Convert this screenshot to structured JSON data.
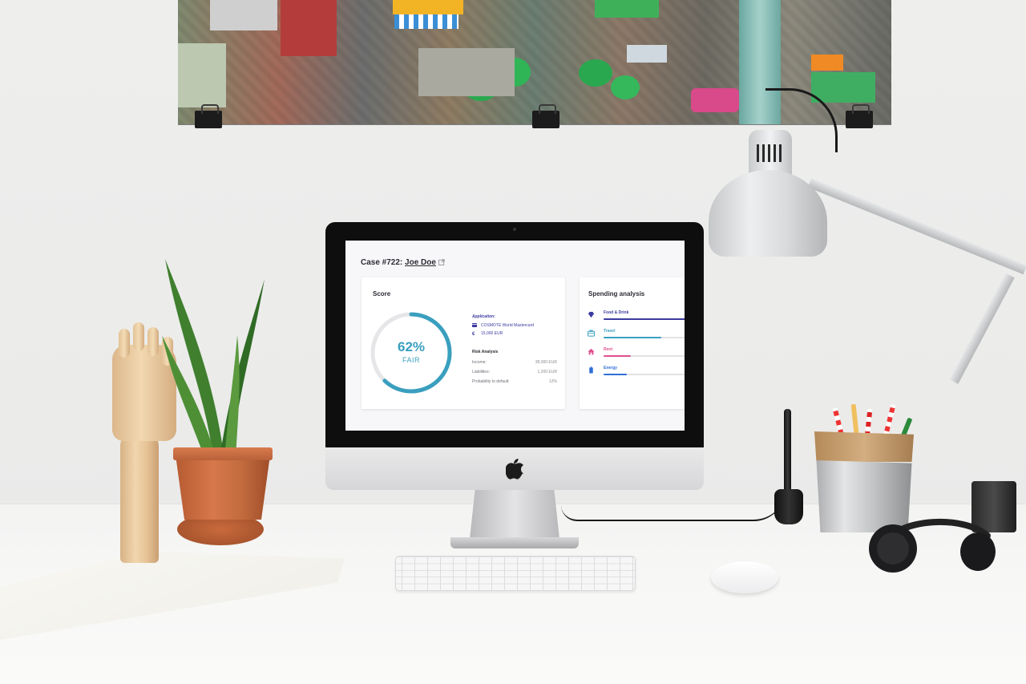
{
  "scene": {
    "description_objects": [
      "poster",
      "imac",
      "keyboard",
      "mouse",
      "plant",
      "wooden-hand",
      "notebook",
      "desk-lamp",
      "pen-holder",
      "stylus",
      "headphones"
    ]
  },
  "dashboard": {
    "case_prefix": "Case #722: ",
    "case_name": "Joe Doe",
    "score": {
      "title": "Score",
      "percent_text": "62%",
      "percent_value": 0.62,
      "rating": "FAIR",
      "gauge_color": "#3a9fbf",
      "track_color": "#e6e6e9"
    },
    "application": {
      "heading": "Application:",
      "card": "COSMOTE World Mastercard",
      "amount": "15,000 EUR"
    },
    "risk": {
      "heading": "Risk Analysis",
      "rows": [
        {
          "label": "Income:",
          "value": "38,000 EUR"
        },
        {
          "label": "Liabilities:",
          "value": "1,200 EUR"
        },
        {
          "label": "Probability to default:",
          "value": "12%"
        }
      ]
    },
    "spending": {
      "title": "Spending analysis",
      "items": [
        {
          "label": "Food & Drink",
          "icon": "diamond-icon",
          "color": "#3b3aa0",
          "fill": 1.0
        },
        {
          "label": "Travel",
          "icon": "briefcase-icon",
          "color": "#3a9fbf",
          "fill": 0.55
        },
        {
          "label": "Rent",
          "icon": "house-icon",
          "color": "#e0508f",
          "fill": 0.26
        },
        {
          "label": "Energy",
          "icon": "battery-icon",
          "color": "#2f6fd6",
          "fill": 0.22
        }
      ]
    }
  },
  "colors": {
    "accent": "#3a9fbf",
    "brand_indigo": "#3b3aa0",
    "pink": "#e0508f"
  }
}
